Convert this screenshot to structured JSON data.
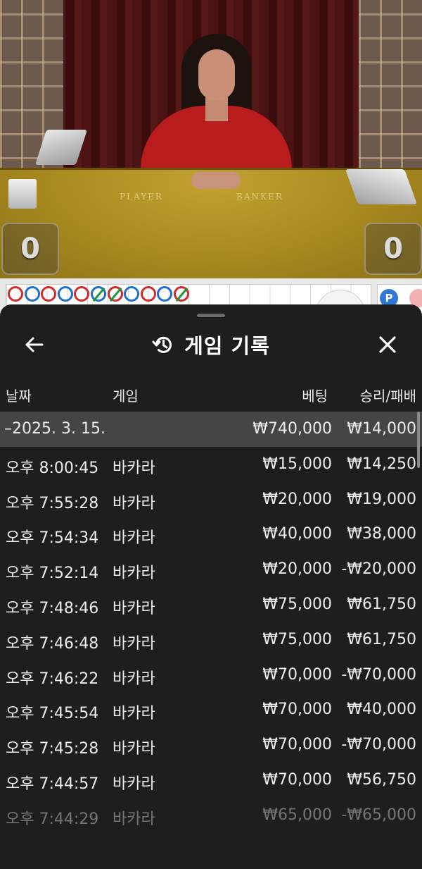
{
  "video": {
    "player_label": "PLAYER",
    "banker_label": "BANKER",
    "player_score": "0",
    "banker_score": "0"
  },
  "road": {
    "beads": [
      {
        "color": "red",
        "tie": false
      },
      {
        "color": "blue",
        "tie": false
      },
      {
        "color": "red",
        "tie": false
      },
      {
        "color": "blue",
        "tie": false
      },
      {
        "color": "red",
        "tie": false
      },
      {
        "color": "blue",
        "tie": true
      },
      {
        "color": "red",
        "tie": true
      },
      {
        "color": "blue",
        "tie": false
      },
      {
        "color": "red",
        "tie": false
      },
      {
        "color": "blue",
        "tie": false
      },
      {
        "color": "red",
        "tie": true
      }
    ],
    "p_badge": "P",
    "colors": {
      "red": "#d32b2b",
      "blue": "#1f6fd1",
      "tie": "#1a9a3a"
    }
  },
  "sheet": {
    "title": "게임 기록",
    "back_icon": "arrow-left-icon",
    "history_icon": "history-icon",
    "close_icon": "close-icon",
    "columns": {
      "date": "날짜",
      "game": "게임",
      "bet": "베팅",
      "result": "승리/패배"
    },
    "summary": {
      "date": "–2025. 3. 15.",
      "bet": "₩740,000",
      "result": "₩14,000"
    },
    "rows": [
      {
        "time": "오후 8:00:45",
        "game": "바카라",
        "bet": "₩15,000",
        "result": "₩14,250"
      },
      {
        "time": "오후 7:55:28",
        "game": "바카라",
        "bet": "₩20,000",
        "result": "₩19,000"
      },
      {
        "time": "오후 7:54:34",
        "game": "바카라",
        "bet": "₩40,000",
        "result": "₩38,000"
      },
      {
        "time": "오후 7:52:14",
        "game": "바카라",
        "bet": "₩20,000",
        "result": "-₩20,000"
      },
      {
        "time": "오후 7:48:46",
        "game": "바카라",
        "bet": "₩75,000",
        "result": "₩61,750"
      },
      {
        "time": "오후 7:46:48",
        "game": "바카라",
        "bet": "₩75,000",
        "result": "₩61,750"
      },
      {
        "time": "오후 7:46:22",
        "game": "바카라",
        "bet": "₩70,000",
        "result": "-₩70,000"
      },
      {
        "time": "오후 7:45:54",
        "game": "바카라",
        "bet": "₩70,000",
        "result": "₩40,000"
      },
      {
        "time": "오후 7:45:28",
        "game": "바카라",
        "bet": "₩70,000",
        "result": "-₩70,000"
      },
      {
        "time": "오후 7:44:57",
        "game": "바카라",
        "bet": "₩70,000",
        "result": "₩56,750"
      },
      {
        "time": "오후 7:44:29",
        "game": "바카라",
        "bet": "₩65,000",
        "result": "-₩65,000"
      }
    ]
  }
}
